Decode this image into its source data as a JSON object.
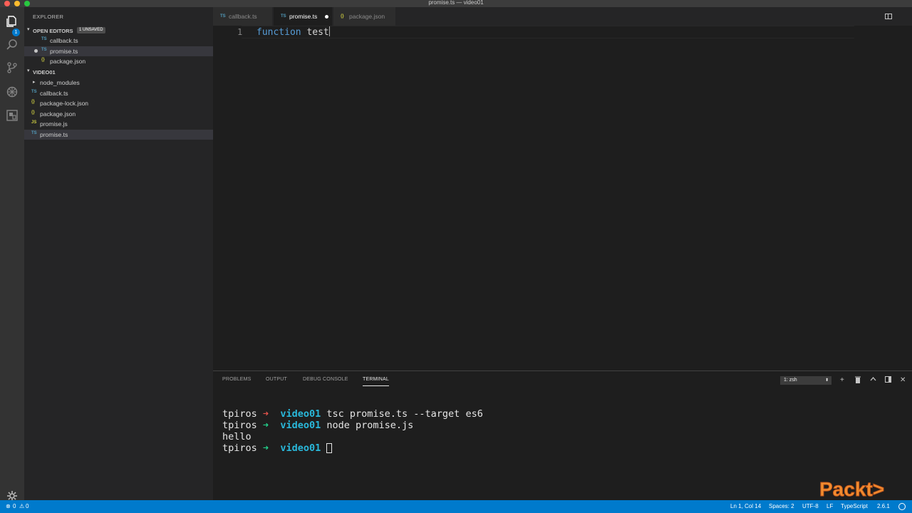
{
  "window": {
    "title": "promise.ts — video01"
  },
  "sidebar": {
    "header": "EXPLORER",
    "open_editors": {
      "label": "OPEN EDITORS",
      "badge": "1 UNSAVED",
      "files": [
        {
          "icon": "TS",
          "name": "callback.ts"
        },
        {
          "icon": "TS",
          "name": "promise.ts"
        },
        {
          "icon": "{}",
          "name": "package.json"
        }
      ]
    },
    "project": {
      "label": "VIDEO01",
      "folder": "node_modules",
      "files": [
        {
          "icon": "TS",
          "name": "callback.ts"
        },
        {
          "icon": "{}",
          "name": "package-lock.json"
        },
        {
          "icon": "{}",
          "name": "package.json"
        },
        {
          "icon": "JS",
          "name": "promise.js"
        },
        {
          "icon": "TS",
          "name": "promise.ts"
        }
      ]
    }
  },
  "activity": {
    "explorer_badge": "1"
  },
  "tabs": [
    {
      "icon": "TS",
      "name": "callback.ts"
    },
    {
      "icon": "TS",
      "name": "promise.ts"
    },
    {
      "icon": "{}",
      "name": "package.json"
    }
  ],
  "editor": {
    "line_number": "1",
    "keyword": "function",
    "identifier": "test"
  },
  "panel": {
    "tabs": [
      "PROBLEMS",
      "OUTPUT",
      "DEBUG CONSOLE",
      "TERMINAL"
    ],
    "terminal_select": "1: zsh",
    "terminal": {
      "user": "tpiros",
      "arrow": "➜",
      "dir": "video01",
      "cmd1": "tsc promise.ts --target es6",
      "cmd2": "node promise.js",
      "output": "hello"
    }
  },
  "status": {
    "errors": "0",
    "warnings": "0",
    "position": "Ln 1, Col 14",
    "spaces": "Spaces: 2",
    "encoding": "UTF-8",
    "eol": "LF",
    "language": "TypeScript",
    "version": "2.6.1"
  },
  "watermark": {
    "text": "Packt>"
  },
  "colors": {
    "accent": "#007acc",
    "keyword": "#569cd6",
    "dir": "#29b8db"
  }
}
